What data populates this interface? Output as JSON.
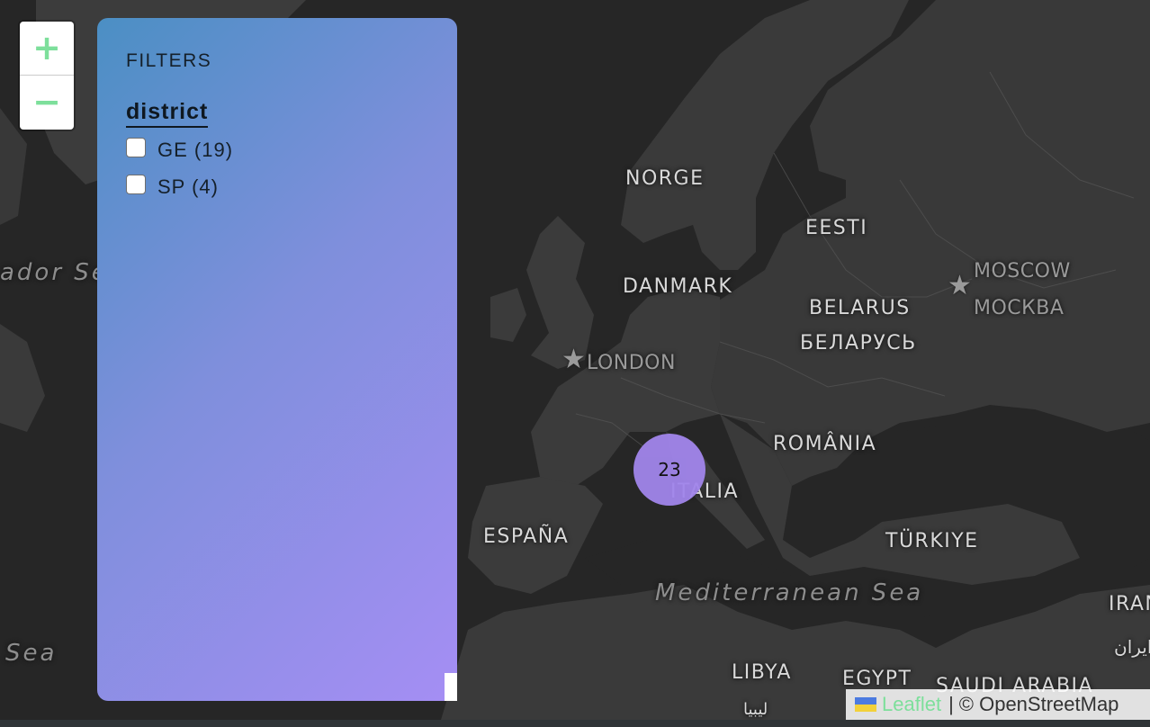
{
  "zoom": {
    "in_label": "+",
    "out_label": "−"
  },
  "filters": {
    "title": "FILTERS",
    "group_title": "district",
    "options": [
      {
        "label": "GE (19)",
        "checked": false
      },
      {
        "label": "SP (4)",
        "checked": false
      }
    ]
  },
  "cluster": {
    "count": "23",
    "color": "#a185eb"
  },
  "map_labels": {
    "countries": {
      "norway": "NORGE",
      "estonia": "EESTI",
      "denmark": "DANMARK",
      "belarus": "BELARUS",
      "belarus_cyr": "БЕЛАРУСЬ",
      "romania": "ROMÂNIA",
      "italy": "ITALIA",
      "spain": "ESPAÑA",
      "turkey": "TÜRKIYE",
      "libya": "LIBYA",
      "egypt": "EGYPT",
      "saudi": "SAUDI ARABIA",
      "iran": "IRAN",
      "iran_ar": "ایران"
    },
    "cities": {
      "london": "LONDON",
      "moscow": "MOSCOW",
      "moscow_cyr": "МОСКВА"
    },
    "seas": {
      "labrador": "ador Sea",
      "mediterranean": "Mediterranean Sea",
      "sea_left": "Sea"
    },
    "libya_partial": "ليبيا"
  },
  "attribution": {
    "leaflet": "Leaflet",
    "separator": "|",
    "osm": "© OpenStreetMap"
  },
  "colors": {
    "land": "#3a3a3a",
    "water": "#262626",
    "panel_gradient_start": "#4b8fc4",
    "panel_gradient_end": "#a58ef4",
    "zoom_accent": "#7ddf9b"
  }
}
